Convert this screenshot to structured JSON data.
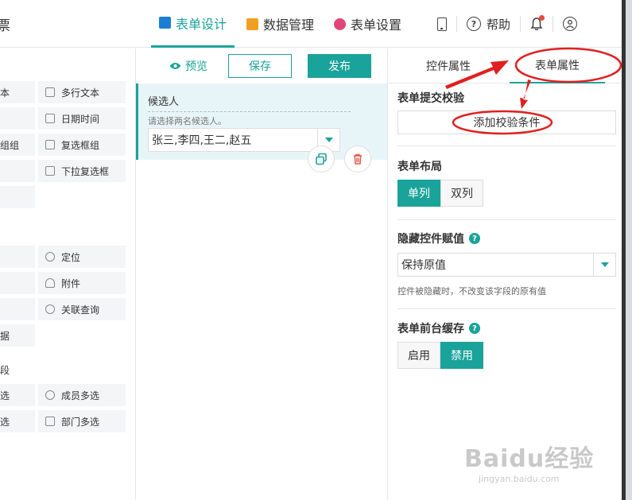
{
  "app": {
    "title_fragment": "票"
  },
  "nav": {
    "tabs": [
      {
        "label": "表单设计",
        "color": "#1a7fd4"
      },
      {
        "label": "数据管理",
        "color": "#f0a020"
      },
      {
        "label": "表单设置",
        "color": "#e2457a"
      }
    ],
    "help_label": "帮助"
  },
  "palette": {
    "left_col": [
      "本",
      "组组",
      "据",
      "选",
      "选"
    ],
    "right_col": [
      "多行文本",
      "日期时间",
      "复选框组",
      "下拉复选框",
      "定位",
      "附件",
      "关联查询",
      "成员多选",
      "部门多选"
    ],
    "section_fragment": "段"
  },
  "toolbar": {
    "preview_label": "预览",
    "save_label": "保存",
    "publish_label": "发布"
  },
  "field": {
    "label": "候选人",
    "hint": "请选择两名候选人。",
    "value": "张三,李四,王二,赵五"
  },
  "props": {
    "tabs": [
      "控件属性",
      "表单属性"
    ],
    "submit_check": {
      "title": "表单提交校验",
      "add_rule_label": "添加校验条件"
    },
    "layout": {
      "title": "表单布局",
      "options": [
        "单列",
        "双列"
      ],
      "selected": "单列"
    },
    "hidden_value": {
      "title": "隐藏控件赋值",
      "value": "保持原值",
      "note": "控件被隐藏时，不改变该字段的原有值"
    },
    "cache": {
      "title": "表单前台缓存",
      "options": [
        "启用",
        "禁用"
      ],
      "selected": "禁用"
    }
  },
  "theme": {
    "accent": "#1aa39a",
    "annotation_red": "#e02020"
  },
  "watermark": {
    "logo": "Baidu经验",
    "url": "jingyan.baidu.com"
  }
}
